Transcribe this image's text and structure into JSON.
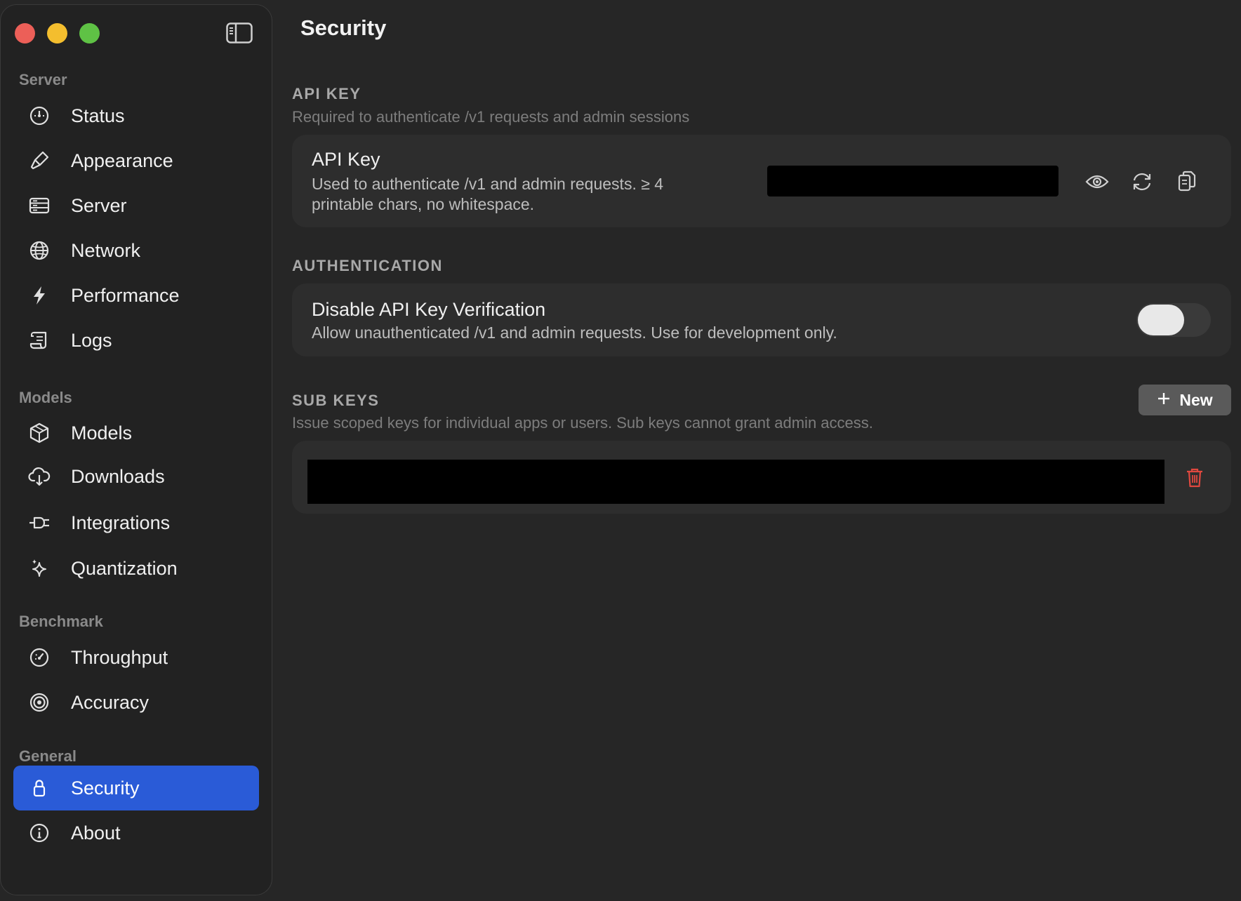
{
  "window": {
    "controls": [
      "close",
      "minimize",
      "zoom"
    ]
  },
  "sidebar": {
    "sections": [
      {
        "label": "Server",
        "items": [
          {
            "label": "Status",
            "icon": "gauge-icon"
          },
          {
            "label": "Appearance",
            "icon": "paintbrush-icon"
          },
          {
            "label": "Server",
            "icon": "server-rack-icon"
          },
          {
            "label": "Network",
            "icon": "globe-icon"
          },
          {
            "label": "Performance",
            "icon": "bolt-icon"
          },
          {
            "label": "Logs",
            "icon": "scroll-icon"
          }
        ]
      },
      {
        "label": "Models",
        "items": [
          {
            "label": "Models",
            "icon": "cube-icon"
          },
          {
            "label": "Downloads",
            "icon": "cloud-download-icon"
          },
          {
            "label": "Integrations",
            "icon": "plug-icon"
          },
          {
            "label": "Quantization",
            "icon": "sparkles-icon"
          }
        ]
      },
      {
        "label": "Benchmark",
        "items": [
          {
            "label": "Throughput",
            "icon": "speedometer-icon"
          },
          {
            "label": "Accuracy",
            "icon": "target-icon"
          }
        ]
      },
      {
        "label": "General",
        "items": [
          {
            "label": "Security",
            "icon": "lock-icon",
            "active": true
          },
          {
            "label": "About",
            "icon": "info-icon"
          }
        ]
      }
    ]
  },
  "main": {
    "title": "Security",
    "api_key_section": {
      "header": "API KEY",
      "description": "Required to authenticate /v1 requests and admin sessions",
      "row_title": "API Key",
      "row_sub_line1": "Used to authenticate /v1 and admin requests. ≥ 4",
      "row_sub_line2": "printable chars, no whitespace."
    },
    "auth_section": {
      "header": "AUTHENTICATION",
      "row_title": "Disable API Key Verification",
      "row_sub": "Allow unauthenticated /v1 and admin requests. Use for development only.",
      "toggle_on": false
    },
    "sub_keys_section": {
      "header": "SUB KEYS",
      "description": "Issue scoped keys for individual apps or users. Sub keys cannot grant admin access.",
      "new_button_label": "New"
    }
  },
  "colors": {
    "accent": "#2a5bd7",
    "delete": "#e0483f",
    "toggle_off_track": "#3a3a3a"
  }
}
